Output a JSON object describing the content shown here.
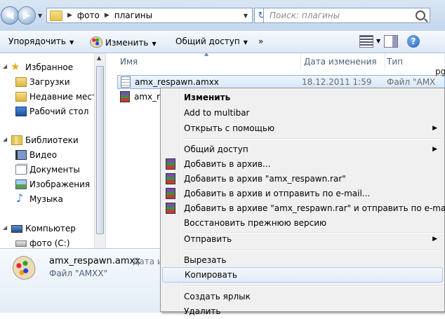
{
  "address": {
    "crumbs": [
      "фото",
      "плагины"
    ]
  },
  "search": {
    "placeholder": "Поиск: плагины"
  },
  "toolbar": {
    "organize": "Упорядочить",
    "change": "Изменить",
    "share": "Общий доступ",
    "more": "»"
  },
  "nav": {
    "favorites": "Избранное",
    "downloads": "Загрузки",
    "recent": "Недавние места",
    "desktop": "Рабочий стол",
    "libraries": "Библиотеки",
    "video": "Видео",
    "documents": "Документы",
    "images": "Изображения",
    "music": "Музыка",
    "computer": "Компьютер",
    "drive_c": "фото (C:)"
  },
  "columns": {
    "name": "Имя",
    "date": "Дата изменения",
    "type": "Тип"
  },
  "files": [
    {
      "name": "amx_respawn.amxx",
      "date": "18.12.2011 1:59",
      "type": "Файл \"AMX"
    },
    {
      "name": "amx_re"
    }
  ],
  "details": {
    "filename": "amx_respawn.amxx",
    "filetype": "Файл \"AMXX\"",
    "modified_label": "Дата из"
  },
  "edge_text": "pg",
  "context_menu": {
    "edit": "Изменить",
    "add_multibar": "Add to multibar",
    "open_with": "Открыть с помощью",
    "share": "Общий доступ",
    "add_archive": "Добавить в архив...",
    "add_archive_named": "Добавить в архив \"amx_respawn.rar\"",
    "add_email": "Добавить в архив и отправить по e-mail...",
    "add_named_email": "Добавить в архиве \"amx_respawn.rar\" и отправить по e-mail",
    "restore": "Восстановить прежнюю версию",
    "send_to": "Отправить",
    "cut": "Вырезать",
    "copy": "Копировать",
    "create_shortcut": "Создать ярлык",
    "delete": "Удалить"
  }
}
